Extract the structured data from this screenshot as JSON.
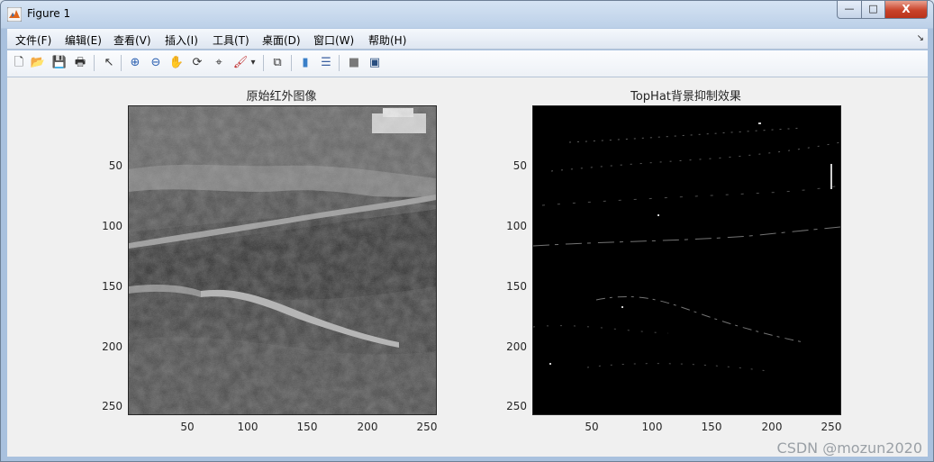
{
  "window": {
    "title": "Figure 1",
    "minimize_label": "—",
    "maximize_label": "□",
    "close_label": "X"
  },
  "menu": {
    "items": [
      {
        "label": "文件(F)"
      },
      {
        "label": "编辑(E)"
      },
      {
        "label": "查看(V)"
      },
      {
        "label": "插入(I)"
      },
      {
        "label": "工具(T)"
      },
      {
        "label": "桌面(D)"
      },
      {
        "label": "窗口(W)"
      },
      {
        "label": "帮助(H)"
      }
    ],
    "corner_arrow": "↘"
  },
  "toolbar": {
    "buttons": [
      {
        "name": "new-figure-icon",
        "glyph": "🗋"
      },
      {
        "name": "open-file-icon",
        "glyph": "📂"
      },
      {
        "name": "save-figure-icon",
        "glyph": "💾"
      },
      {
        "name": "print-figure-icon",
        "glyph": "🖶"
      },
      {
        "name": "edit-plot-icon",
        "glyph": "↖"
      },
      {
        "name": "zoom-in-icon",
        "glyph": "⊕"
      },
      {
        "name": "zoom-out-icon",
        "glyph": "⊖"
      },
      {
        "name": "pan-hand-icon",
        "glyph": "✋"
      },
      {
        "name": "rotate-3d-icon",
        "glyph": "⟳"
      },
      {
        "name": "data-cursor-icon",
        "glyph": "⌖"
      },
      {
        "name": "brush-icon",
        "glyph": "🖌"
      },
      {
        "name": "brush-dropdown-icon",
        "glyph": "▾"
      },
      {
        "name": "link-plot-icon",
        "glyph": "⧉"
      },
      {
        "name": "insert-colorbar-icon",
        "glyph": "▮"
      },
      {
        "name": "insert-legend-icon",
        "glyph": "☰"
      },
      {
        "name": "hide-plot-tools-icon",
        "glyph": "■"
      },
      {
        "name": "show-plot-tools-icon",
        "glyph": "▣"
      }
    ]
  },
  "figure": {
    "left_axes": {
      "title": "原始红外图像",
      "yticks": [
        "50",
        "100",
        "150",
        "200",
        "250"
      ],
      "xticks": [
        "50",
        "100",
        "150",
        "200",
        "250"
      ]
    },
    "right_axes": {
      "title": "TopHat背景抑制效果",
      "yticks": [
        "50",
        "100",
        "150",
        "200",
        "250"
      ],
      "xticks": [
        "50",
        "100",
        "150",
        "200",
        "250"
      ]
    }
  },
  "watermark": "CSDN @mozun2020",
  "chart_data": [
    {
      "type": "heatmap",
      "title": "原始红外图像",
      "colormap": "gray",
      "xlim": [
        0.5,
        256.5
      ],
      "ylim": [
        0.5,
        256.5
      ],
      "y_reversed": true,
      "xticks": [
        50,
        100,
        150,
        200,
        250
      ],
      "yticks": [
        50,
        100,
        150,
        200,
        250
      ]
    },
    {
      "type": "heatmap",
      "title": "TopHat背景抑制效果",
      "colormap": "gray",
      "xlim": [
        0.5,
        256.5
      ],
      "ylim": [
        0.5,
        256.5
      ],
      "y_reversed": true,
      "xticks": [
        50,
        100,
        150,
        200,
        250
      ],
      "yticks": [
        50,
        100,
        150,
        200,
        250
      ]
    }
  ]
}
